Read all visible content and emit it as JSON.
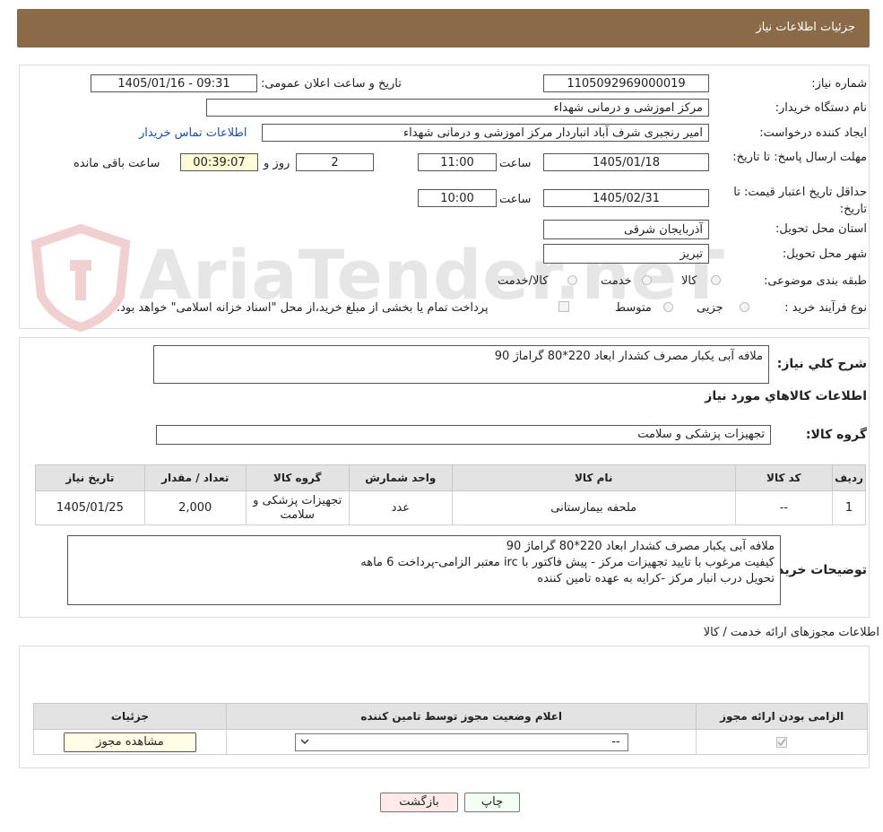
{
  "header": {
    "title": "جزئیات اطلاعات نیاز"
  },
  "watermark": "AriaTender.neT",
  "form": {
    "need_number_label": "شماره نیاز:",
    "need_number": "1105092969000019",
    "announce_label": "تاریخ و ساعت اعلان عمومی:",
    "announce_value": "1405/01/16 - 09:31",
    "buyer_org_label": "نام دستگاه خریدار:",
    "buyer_org": "مرکز اموزشی و درمانی شهداء",
    "requester_label": "ایجاد کننده درخواست:",
    "requester": "امیر رنجبری شرف آباد انباردار مرکز اموزشی و درمانی شهداء",
    "contact_link": "اطلاعات تماس خریدار",
    "reply_deadline_label": "مهلت ارسال پاسخ: تا تاریخ:",
    "reply_date": "1405/01/18",
    "time_label": "ساعت",
    "reply_time": "11:00",
    "days_value": "2",
    "days_label": "روز و",
    "remaining_time": "00:39:07",
    "remaining_label": "ساعت باقی مانده",
    "price_validity_label": "حداقل تاریخ اعتبار قیمت: تا تاریخ:",
    "price_date": "1405/02/31",
    "price_time": "10:00",
    "province_label": "استان محل تحویل:",
    "province": "آذربایجان شرقی",
    "city_label": "شهر محل تحویل:",
    "city": "تبریز",
    "category_label": "طبقه بندی موضوعی:",
    "category_options": [
      "کالا",
      "خدمت",
      "کالا/خدمت"
    ],
    "process_label": "نوع فرآیند خرید :",
    "process_options": [
      "جزیی",
      "متوسط"
    ],
    "payment_note": "پرداخت تمام یا بخشی از مبلغ خرید،از محل \"اسناد خزانه اسلامی\" خواهد بود."
  },
  "summary": {
    "label": "شرح کلي نياز:",
    "text": "ملافه آبی یکبار مصرف کشدار ابعاد 220*80 گراماژ 90",
    "goods_info_title": "اطلاعات کالاهاي مورد نياز",
    "goods_group_label": "گروه کالا:",
    "goods_group": "تجهیزات پزشکی و سلامت"
  },
  "goods_table": {
    "headers": [
      "رديف",
      "کد کالا",
      "نام کالا",
      "واحد شمارش",
      "گروه کالا",
      "تعداد / مقدار",
      "تاريخ نياز"
    ],
    "rows": [
      [
        "1",
        "--",
        "ملحفه بیمارستانی",
        "عدد",
        "تجهیزات پزشکی و سلامت",
        "2,000",
        "1405/01/25"
      ]
    ]
  },
  "buyer_notes": {
    "label": "توضيحات خريدار:",
    "lines": [
      "ملافه آبی یکبار مصرف کشدار ابعاد 220*80 گراماژ 90",
      "کیفیت مرغوب با تایید تجهیزات مرکز -  پیش فاکتور با irc  معتبر الزامی-پرداخت 6 ماهه",
      "تحویل درب انبار مرکز -کرایه به عهده تامین کننده"
    ]
  },
  "permits": {
    "title": "اطلاعات مجوزهای ارائه خدمت / کالا",
    "headers": [
      "الزامی بودن ارائه مجوز",
      "اعلام وضعیت مجوز توسط تامین کننده",
      "جزئیات"
    ],
    "select_value": "--",
    "view_button": "مشاهده مجوز"
  },
  "footer": {
    "print_button": "چاپ",
    "back_button": "بازگشت"
  }
}
